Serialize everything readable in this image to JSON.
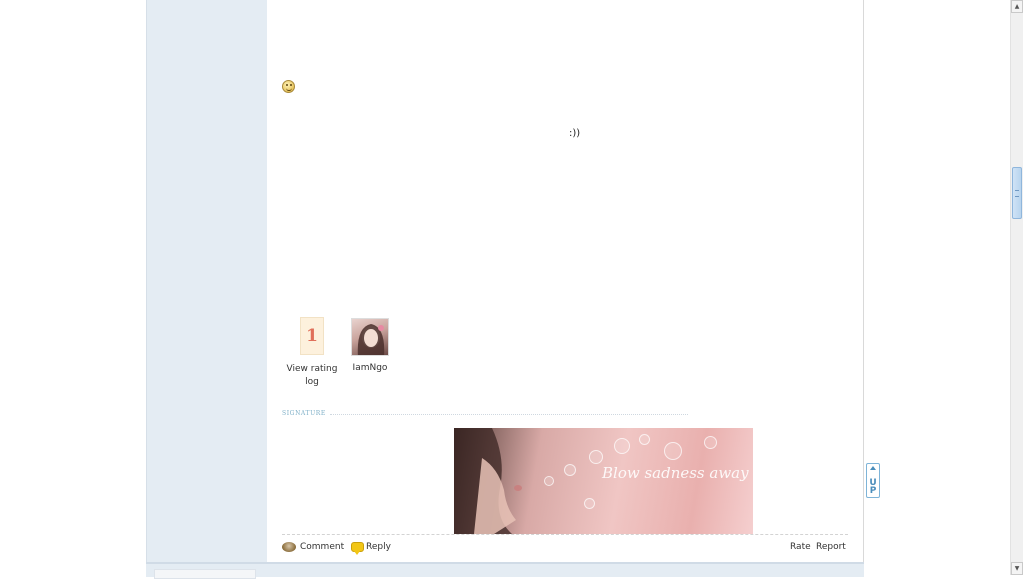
{
  "post": {
    "text": ":))"
  },
  "rating": {
    "value": "1",
    "view_log_label": "View rating log",
    "rater_name": "IamNgo"
  },
  "signature": {
    "label": "SIGNATURE",
    "banner_text": "Blow sadness away"
  },
  "footer": {
    "comment_label": "Comment",
    "reply_label": "Reply",
    "rate_label": "Rate",
    "report_label": "Report"
  },
  "up_button": {
    "label_u": "U",
    "label_p": "P"
  },
  "scrollbar": {
    "up_glyph": "▲",
    "down_glyph": "▼"
  },
  "colors": {
    "sidebar_bg": "#e4ecf3",
    "rating_number": "#e0705a",
    "signature_label": "#7fb0c8",
    "up_button_accent": "#4a8dbb"
  }
}
